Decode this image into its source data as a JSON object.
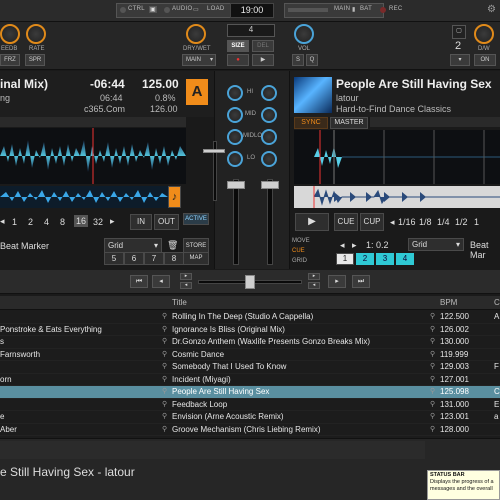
{
  "topbar": {
    "ctrl_label": "CTRL",
    "audio_label": "AUDIO",
    "load_label": "LOAD",
    "clock": "19:00",
    "main_label": "MAIN",
    "bat_label": "BAT",
    "rec_label": "REC"
  },
  "upper": {
    "left_labels": [
      "EEDB",
      "RATE"
    ],
    "frz_label": "FRZ",
    "spr_label": "SPR",
    "drywet_label": "DRY/WET",
    "main_select": "MAIN",
    "loop_size_value": "4",
    "size_label": "SIZE",
    "del_label": "DEL",
    "vol_label": "VOL",
    "s_label": "S",
    "q_label": "Q",
    "right_counter": "2",
    "dw_label": "D/W",
    "on_label": "ON"
  },
  "deck_a": {
    "title_partial": "inal Mix)",
    "artist_partial": "ng",
    "label_partial": "c365.Com",
    "time_remaining": "-06:44",
    "time_elapsed": "06:44",
    "bpm": "125.00",
    "pitch": "0.8%",
    "original_bpm": "126.00",
    "letter": "A",
    "loop_sizes": [
      "1",
      "2",
      "4",
      "8",
      "16",
      "32"
    ],
    "in_label": "IN",
    "out_label": "OUT",
    "active_label": "ACTIVE",
    "beat_marker_label": "Beat Marker",
    "grid_label": "Grid",
    "store_label": "STORE",
    "map_label": "MAP",
    "hotcues": [
      "5",
      "6",
      "7",
      "8"
    ]
  },
  "deck_b": {
    "title": "People Are Still Having Sex",
    "artist": "latour",
    "album": "Hard-to-Find Dance Classics",
    "sync_label": "SYNC",
    "master_label": "MASTER",
    "cue_label": "CUE",
    "cup_label": "CUP",
    "loop_sizes": [
      "1/16",
      "1/8",
      "1/4",
      "1/2",
      "1"
    ],
    "move_label": "MOVE",
    "cue_tab_label": "CUE",
    "grid_tab_label": "GRID",
    "move_value": "1: 0.2",
    "beat_marker_label": "Beat Mar",
    "grid_label": "Grid",
    "hotcues": [
      "1",
      "2",
      "3",
      "4"
    ]
  },
  "mixer": {
    "eq_labels": [
      "HI",
      "MID",
      "MIDLO",
      "LO"
    ]
  },
  "browser": {
    "columns": [
      "Title",
      "BPM",
      "C"
    ],
    "rows": [
      {
        "artist": "",
        "title": "Rolling In The Deep (Studio A Cappella)",
        "bpm": "122.500",
        "key": "A"
      },
      {
        "artist": "Ponstroke & Eats Everything",
        "title": "Ignorance Is Bliss (Original Mix)",
        "bpm": "126.002",
        "key": ""
      },
      {
        "artist": "s",
        "title": "Dr.Gonzo Anthem (Waxlife Presents Gonzo Breaks Mix)",
        "bpm": "130.000",
        "key": ""
      },
      {
        "artist": "Farnsworth",
        "title": "Cosmic Dance",
        "bpm": "119.999",
        "key": ""
      },
      {
        "artist": "",
        "title": "Somebody That I Used To Know",
        "bpm": "129.003",
        "key": "F"
      },
      {
        "artist": "orn",
        "title": "Incident (Miyagi)",
        "bpm": "127.001",
        "key": ""
      },
      {
        "artist": "",
        "title": "People Are Still Having Sex",
        "bpm": "125.098",
        "key": "C",
        "selected": true
      },
      {
        "artist": "",
        "title": "Feedback Loop",
        "bpm": "131.000",
        "key": "E"
      },
      {
        "artist": "e",
        "title": "Envision (Arne Acoustic Remix)",
        "bpm": "123.001",
        "key": "a"
      },
      {
        "artist": "Aber",
        "title": "Groove Mechanism (Chris Liebing Remix)",
        "bpm": "128.000",
        "key": ""
      }
    ]
  },
  "bottom": {
    "now_playing": "e Still Having Sex - latour",
    "status_title": "STATUS BAR",
    "status_text": "Displays the progress of a messages and the overall"
  },
  "colors": {
    "accent_orange": "#f08c1a",
    "accent_cyan": "#2fc9d4",
    "selected_row": "#5a8fa0"
  }
}
